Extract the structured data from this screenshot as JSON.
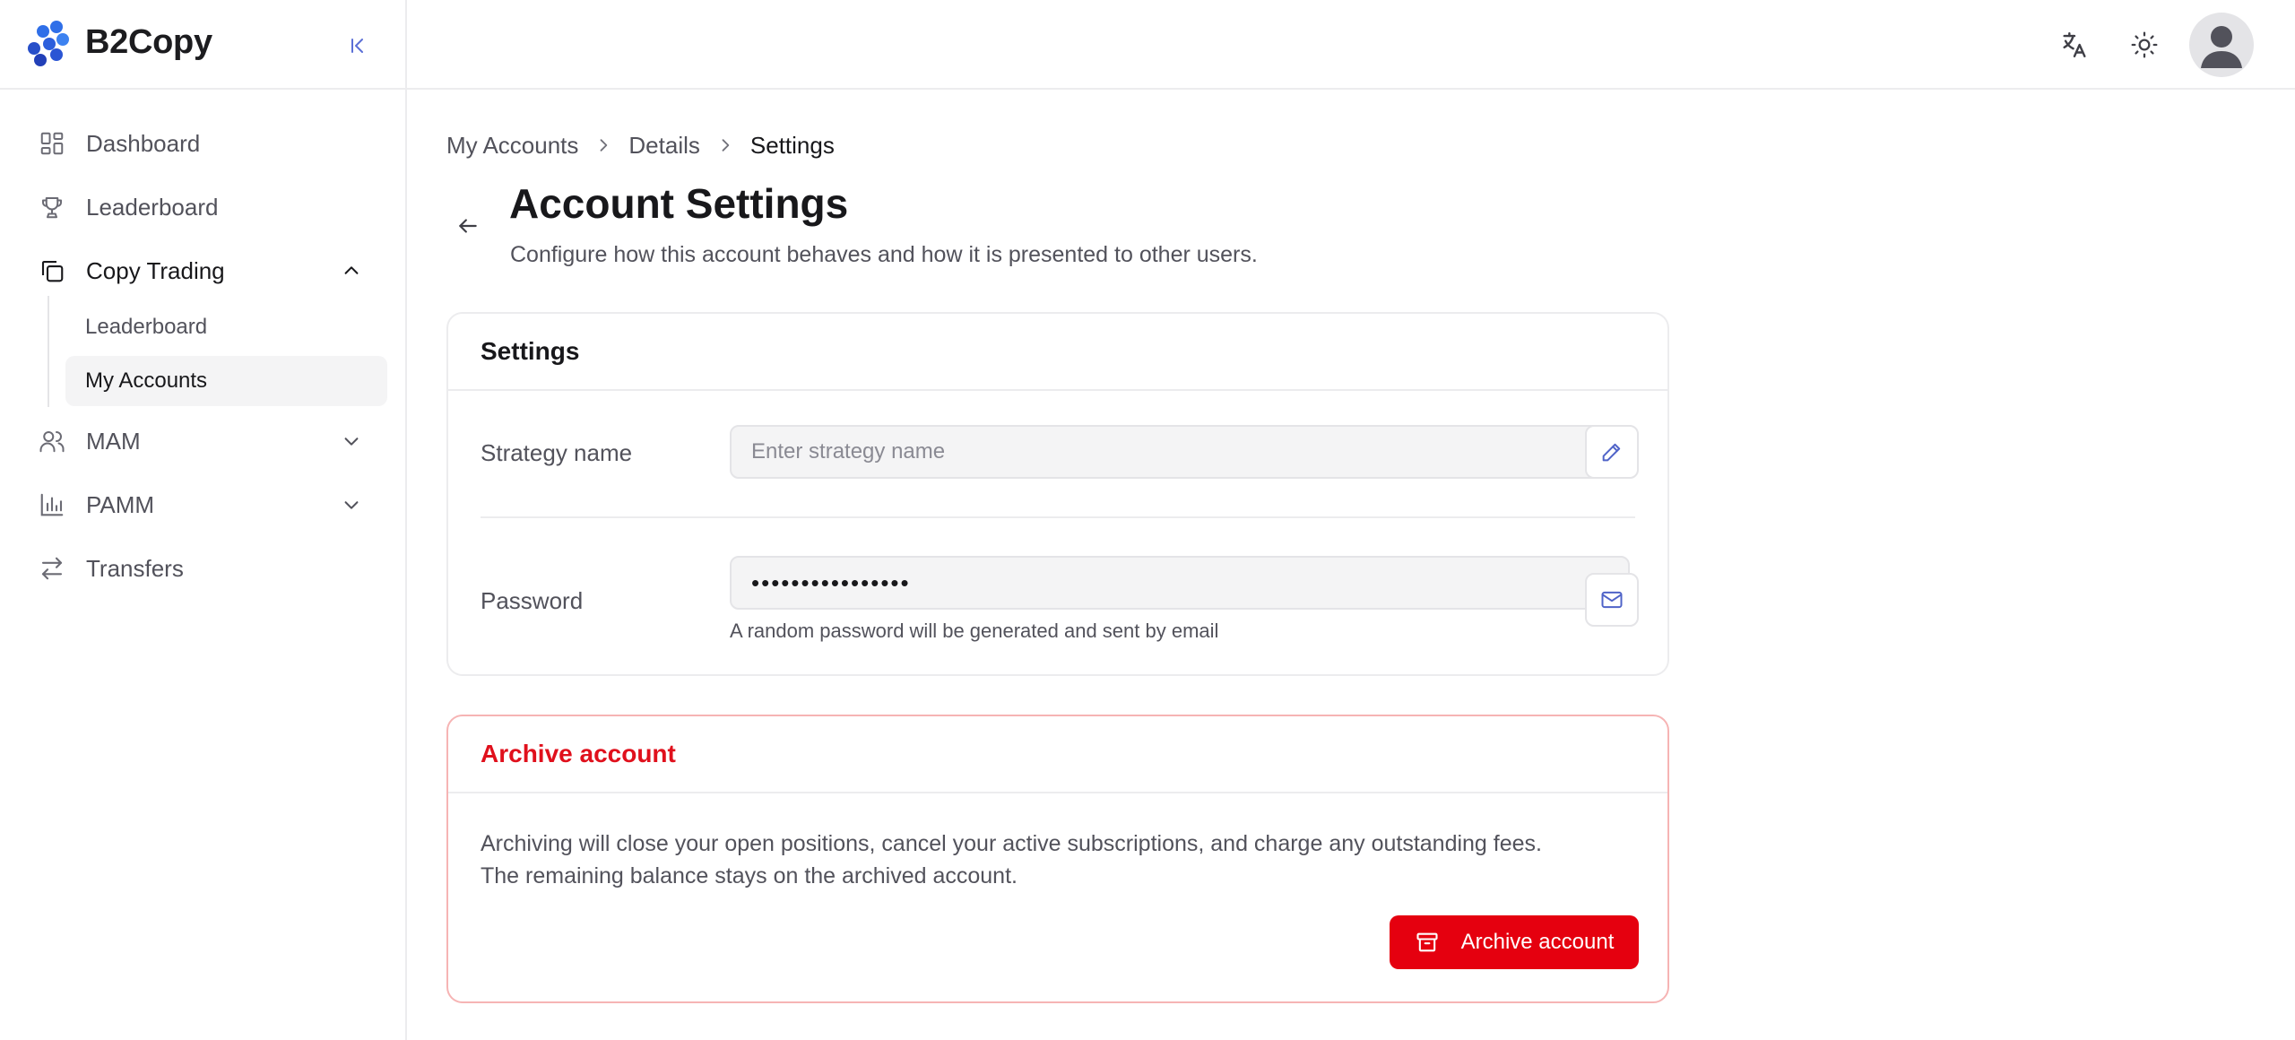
{
  "app": {
    "name": "B2Copy",
    "logo_icon": "dots-logo-icon",
    "collapse_icon": "collapse-sidebar-icon"
  },
  "sidebar": {
    "items": [
      {
        "label": "Dashboard",
        "icon": "dashboard-icon"
      },
      {
        "label": "Leaderboard",
        "icon": "trophy-icon"
      },
      {
        "label": "Copy Trading",
        "icon": "copy-icon",
        "expanded": true
      },
      {
        "label": "MAM",
        "icon": "users-icon",
        "expanded": false
      },
      {
        "label": "PAMM",
        "icon": "bar-chart-icon",
        "expanded": false
      },
      {
        "label": "Transfers",
        "icon": "transfer-arrows-icon"
      }
    ],
    "copy_trading_sub": [
      {
        "label": "Leaderboard"
      },
      {
        "label": "My Accounts",
        "selected": true
      }
    ]
  },
  "topbar": {
    "icons": [
      "translate-icon",
      "sun-icon",
      "user-avatar-icon"
    ]
  },
  "breadcrumb": [
    "My Accounts",
    "Details",
    "Settings"
  ],
  "header": {
    "title": "Account Settings",
    "subtitle": "Configure how this account behaves and how it is presented to other users."
  },
  "settings_card": {
    "title": "Settings",
    "strategy_label": "Strategy name",
    "strategy_placeholder": "Enter strategy name",
    "strategy_value": "",
    "password_label": "Password",
    "password_value": "••••••••••••••••",
    "password_hint": "A random password will be generated and sent by email"
  },
  "archive_card": {
    "title": "Archive account",
    "description_line1": "Archiving will close your open positions, cancel your active subscriptions, and charge any outstanding fees.",
    "description_line2": "The remaining balance stays on the archived account.",
    "button_label": "Archive account"
  },
  "colors": {
    "accent": "#3b5bdb",
    "danger": "#e5000f",
    "danger_border": "#f6b4b4"
  }
}
